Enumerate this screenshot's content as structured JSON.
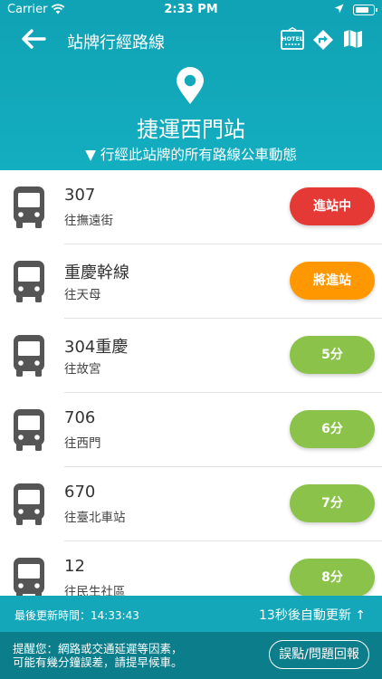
{
  "status_bar": {
    "carrier": "Carrier",
    "time": "2:33 PM"
  },
  "header": {
    "title": "站牌行經路線",
    "stop_name": "捷運西門站",
    "subtitle": "▼ 行經此站牌的所有路線公車動態",
    "hotel_label": "HOTEL"
  },
  "routes": [
    {
      "name": "307",
      "destination": "往撫遠街",
      "eta": "進站中",
      "color": "#e53935"
    },
    {
      "name": "重慶幹線",
      "destination": "往天母",
      "eta": "將進站",
      "color": "#ff9800"
    },
    {
      "name": "304重慶",
      "destination": "往故宮",
      "eta": "5分",
      "color": "#8bc34a"
    },
    {
      "name": "706",
      "destination": "往西門",
      "eta": "6分",
      "color": "#8bc34a"
    },
    {
      "name": "670",
      "destination": "往臺北車站",
      "eta": "7分",
      "color": "#8bc34a"
    },
    {
      "name": "12",
      "destination": "往民生社區",
      "eta": "8分",
      "color": "#8bc34a"
    }
  ],
  "update_bar": {
    "last_update": "最後更新時間：14:33:43",
    "auto_refresh": "13秒後自動更新 ↑"
  },
  "footer": {
    "notice_line1": "提醒您：網路或交通延遲等因素，",
    "notice_line2": "可能有幾分鐘誤差，請提早候車。",
    "report_button": "誤點/問題回報"
  },
  "colors": {
    "primary": "#10a3b5",
    "footer": "#0c7d8a"
  }
}
